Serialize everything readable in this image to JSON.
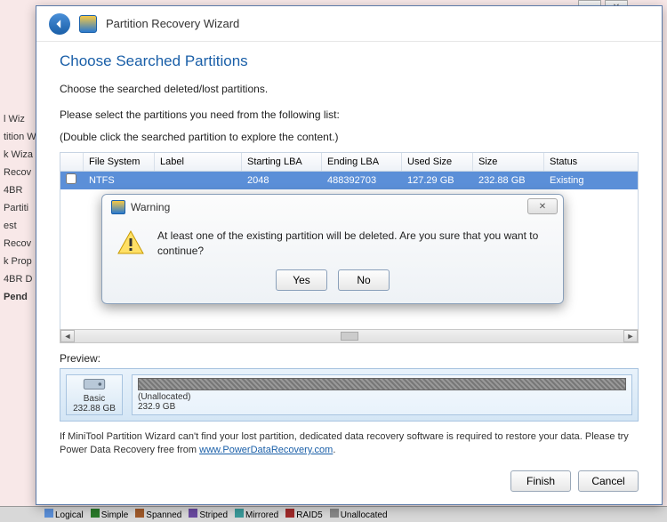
{
  "window": {
    "title": "Partition Recovery Wizard"
  },
  "page": {
    "heading": "Choose Searched Partitions",
    "subheading": "Choose the searched deleted/lost partitions.",
    "instr1": "Please select the partitions you need from the following list:",
    "instr2": "(Double click the searched partition to explore the content.)"
  },
  "table": {
    "headers": {
      "fs": "File System",
      "lbl": "Label",
      "slba": "Starting LBA",
      "elba": "Ending LBA",
      "used": "Used Size",
      "sz": "Size",
      "st": "Status"
    },
    "row": {
      "fs": "NTFS",
      "lbl": "",
      "slba": "2048",
      "elba": "488392703",
      "used": "127.29 GB",
      "sz": "232.88 GB",
      "st": "Existing"
    }
  },
  "preview": {
    "label": "Preview:",
    "disk_type": "Basic",
    "disk_size": "232.88 GB",
    "alloc_label": "(Unallocated)",
    "alloc_size": "232.9 GB"
  },
  "footer": {
    "text1": "If MiniTool Partition Wizard can't find your lost partition, dedicated data recovery software is required to restore your data. Please try Power Data Recovery free from ",
    "link": "www.PowerDataRecovery.com",
    "text2": "."
  },
  "buttons": {
    "finish": "Finish",
    "cancel": "Cancel"
  },
  "dialog": {
    "title": "Warning",
    "message": "At least one of the existing partition will be deleted. Are you sure that you want to continue?",
    "yes": "Yes",
    "no": "No"
  },
  "bg_items": [
    "l Wiz",
    "tition W",
    "k Wiza",
    "Recov",
    "4BR",
    "Partiti",
    "est",
    "Recov",
    "k Prop",
    "4BR D",
    "Pend"
  ],
  "legend": [
    "Logical",
    "Simple",
    "Spanned",
    "Striped",
    "Mirrored",
    "RAID5",
    "Unallocated"
  ],
  "legend_colors": [
    "#5b8fd8",
    "#2a7a2a",
    "#a05a2a",
    "#6a4aa0",
    "#3a9a9a",
    "#a02a2a",
    "#888"
  ]
}
